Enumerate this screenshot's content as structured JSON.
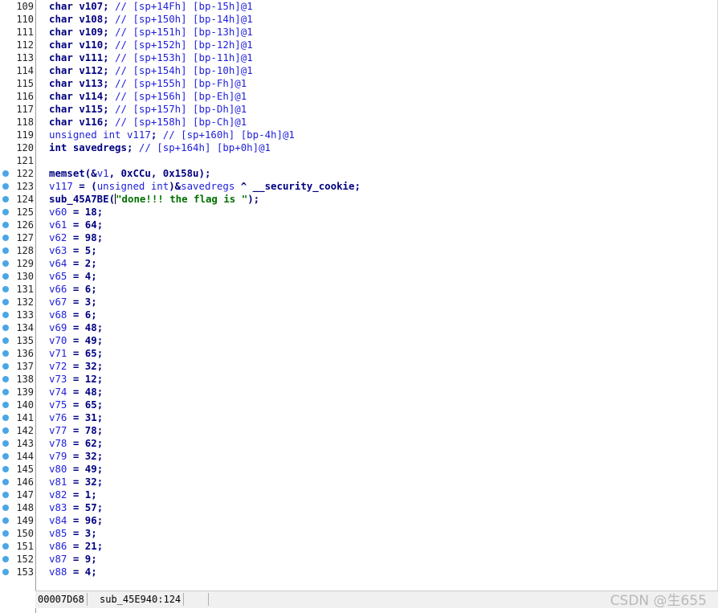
{
  "code_lines": [
    {
      "no": "109",
      "bp": false,
      "segs": [
        [
          "kw",
          "char "
        ],
        [
          "id",
          "v107"
        ],
        [
          "kw",
          "; "
        ],
        [
          "cm",
          "// [sp+14Fh] [bp-15h]@1"
        ]
      ]
    },
    {
      "no": "110",
      "bp": false,
      "segs": [
        [
          "kw",
          "char "
        ],
        [
          "id",
          "v108"
        ],
        [
          "kw",
          "; "
        ],
        [
          "cm",
          "// [sp+150h] [bp-14h]@1"
        ]
      ]
    },
    {
      "no": "111",
      "bp": false,
      "segs": [
        [
          "kw",
          "char "
        ],
        [
          "id",
          "v109"
        ],
        [
          "kw",
          "; "
        ],
        [
          "cm",
          "// [sp+151h] [bp-13h]@1"
        ]
      ]
    },
    {
      "no": "112",
      "bp": false,
      "segs": [
        [
          "kw",
          "char "
        ],
        [
          "id",
          "v110"
        ],
        [
          "kw",
          "; "
        ],
        [
          "cm",
          "// [sp+152h] [bp-12h]@1"
        ]
      ]
    },
    {
      "no": "113",
      "bp": false,
      "segs": [
        [
          "kw",
          "char "
        ],
        [
          "id",
          "v111"
        ],
        [
          "kw",
          "; "
        ],
        [
          "cm",
          "// [sp+153h] [bp-11h]@1"
        ]
      ]
    },
    {
      "no": "114",
      "bp": false,
      "segs": [
        [
          "kw",
          "char "
        ],
        [
          "id",
          "v112"
        ],
        [
          "kw",
          "; "
        ],
        [
          "cm",
          "// [sp+154h] [bp-10h]@1"
        ]
      ]
    },
    {
      "no": "115",
      "bp": false,
      "segs": [
        [
          "kw",
          "char "
        ],
        [
          "id",
          "v113"
        ],
        [
          "kw",
          "; "
        ],
        [
          "cm",
          "// [sp+155h] [bp-Fh]@1"
        ]
      ]
    },
    {
      "no": "116",
      "bp": false,
      "segs": [
        [
          "kw",
          "char "
        ],
        [
          "id",
          "v114"
        ],
        [
          "kw",
          "; "
        ],
        [
          "cm",
          "// [sp+156h] [bp-Eh]@1"
        ]
      ]
    },
    {
      "no": "117",
      "bp": false,
      "segs": [
        [
          "kw",
          "char "
        ],
        [
          "id",
          "v115"
        ],
        [
          "kw",
          "; "
        ],
        [
          "cm",
          "// [sp+157h] [bp-Dh]@1"
        ]
      ]
    },
    {
      "no": "118",
      "bp": false,
      "segs": [
        [
          "kw",
          "char "
        ],
        [
          "id",
          "v116"
        ],
        [
          "kw",
          "; "
        ],
        [
          "cm",
          "// [sp+158h] [bp-Ch]@1"
        ]
      ]
    },
    {
      "no": "119",
      "bp": false,
      "segs": [
        [
          "var",
          "unsigned int v117"
        ],
        [
          "kw",
          "; "
        ],
        [
          "cm",
          "// [sp+160h] [bp-4h]@1"
        ]
      ]
    },
    {
      "no": "120",
      "bp": false,
      "segs": [
        [
          "kw",
          "int savedregs; "
        ],
        [
          "cm",
          "// [sp+164h] [bp+0h]@1"
        ]
      ]
    },
    {
      "no": "121",
      "bp": false,
      "segs": []
    },
    {
      "no": "122",
      "bp": true,
      "segs": [
        [
          "kw",
          "memset(&"
        ],
        [
          "var",
          "v1"
        ],
        [
          "kw",
          ", 0xCCu, 0x158u);"
        ]
      ]
    },
    {
      "no": "123",
      "bp": true,
      "segs": [
        [
          "var",
          "v117"
        ],
        [
          "kw",
          " = ("
        ],
        [
          "var",
          "unsigned int"
        ],
        [
          "kw",
          ")&"
        ],
        [
          "var",
          "savedregs"
        ],
        [
          "kw",
          " ^ __security_cookie;"
        ]
      ]
    },
    {
      "no": "124",
      "bp": true,
      "segs": [
        [
          "kw",
          "sub_45A7BE("
        ],
        [
          "cursor",
          ""
        ],
        [
          "str",
          "\"done!!! the flag is \""
        ],
        [
          "kw",
          ");"
        ]
      ]
    },
    {
      "no": "125",
      "bp": true,
      "segs": [
        [
          "var",
          "v60"
        ],
        [
          "kw",
          " = 18;"
        ]
      ]
    },
    {
      "no": "126",
      "bp": true,
      "segs": [
        [
          "var",
          "v61"
        ],
        [
          "kw",
          " = 64;"
        ]
      ]
    },
    {
      "no": "127",
      "bp": true,
      "segs": [
        [
          "var",
          "v62"
        ],
        [
          "kw",
          " = 98;"
        ]
      ]
    },
    {
      "no": "128",
      "bp": true,
      "segs": [
        [
          "var",
          "v63"
        ],
        [
          "kw",
          " = 5;"
        ]
      ]
    },
    {
      "no": "129",
      "bp": true,
      "segs": [
        [
          "var",
          "v64"
        ],
        [
          "kw",
          " = 2;"
        ]
      ]
    },
    {
      "no": "130",
      "bp": true,
      "segs": [
        [
          "var",
          "v65"
        ],
        [
          "kw",
          " = 4;"
        ]
      ]
    },
    {
      "no": "131",
      "bp": true,
      "segs": [
        [
          "var",
          "v66"
        ],
        [
          "kw",
          " = 6;"
        ]
      ]
    },
    {
      "no": "132",
      "bp": true,
      "segs": [
        [
          "var",
          "v67"
        ],
        [
          "kw",
          " = 3;"
        ]
      ]
    },
    {
      "no": "133",
      "bp": true,
      "segs": [
        [
          "var",
          "v68"
        ],
        [
          "kw",
          " = 6;"
        ]
      ]
    },
    {
      "no": "134",
      "bp": true,
      "segs": [
        [
          "var",
          "v69"
        ],
        [
          "kw",
          " = 48;"
        ]
      ]
    },
    {
      "no": "135",
      "bp": true,
      "segs": [
        [
          "var",
          "v70"
        ],
        [
          "kw",
          " = 49;"
        ]
      ]
    },
    {
      "no": "136",
      "bp": true,
      "segs": [
        [
          "var",
          "v71"
        ],
        [
          "kw",
          " = 65;"
        ]
      ]
    },
    {
      "no": "137",
      "bp": true,
      "segs": [
        [
          "var",
          "v72"
        ],
        [
          "kw",
          " = 32;"
        ]
      ]
    },
    {
      "no": "138",
      "bp": true,
      "segs": [
        [
          "var",
          "v73"
        ],
        [
          "kw",
          " = 12;"
        ]
      ]
    },
    {
      "no": "139",
      "bp": true,
      "segs": [
        [
          "var",
          "v74"
        ],
        [
          "kw",
          " = 48;"
        ]
      ]
    },
    {
      "no": "140",
      "bp": true,
      "segs": [
        [
          "var",
          "v75"
        ],
        [
          "kw",
          " = 65;"
        ]
      ]
    },
    {
      "no": "141",
      "bp": true,
      "segs": [
        [
          "var",
          "v76"
        ],
        [
          "kw",
          " = 31;"
        ]
      ]
    },
    {
      "no": "142",
      "bp": true,
      "segs": [
        [
          "var",
          "v77"
        ],
        [
          "kw",
          " = 78;"
        ]
      ]
    },
    {
      "no": "143",
      "bp": true,
      "segs": [
        [
          "var",
          "v78"
        ],
        [
          "kw",
          " = 62;"
        ]
      ]
    },
    {
      "no": "144",
      "bp": true,
      "segs": [
        [
          "var",
          "v79"
        ],
        [
          "kw",
          " = 32;"
        ]
      ]
    },
    {
      "no": "145",
      "bp": true,
      "segs": [
        [
          "var",
          "v80"
        ],
        [
          "kw",
          " = 49;"
        ]
      ]
    },
    {
      "no": "146",
      "bp": true,
      "segs": [
        [
          "var",
          "v81"
        ],
        [
          "kw",
          " = 32;"
        ]
      ]
    },
    {
      "no": "147",
      "bp": true,
      "segs": [
        [
          "var",
          "v82"
        ],
        [
          "kw",
          " = 1;"
        ]
      ]
    },
    {
      "no": "148",
      "bp": true,
      "segs": [
        [
          "var",
          "v83"
        ],
        [
          "kw",
          " = 57;"
        ]
      ]
    },
    {
      "no": "149",
      "bp": true,
      "segs": [
        [
          "var",
          "v84"
        ],
        [
          "kw",
          " = 96;"
        ]
      ]
    },
    {
      "no": "150",
      "bp": true,
      "segs": [
        [
          "var",
          "v85"
        ],
        [
          "kw",
          " = 3;"
        ]
      ]
    },
    {
      "no": "151",
      "bp": true,
      "segs": [
        [
          "var",
          "v86"
        ],
        [
          "kw",
          " = 21;"
        ]
      ]
    },
    {
      "no": "152",
      "bp": true,
      "segs": [
        [
          "var",
          "v87"
        ],
        [
          "kw",
          " = 9;"
        ]
      ]
    },
    {
      "no": "153",
      "bp": true,
      "segs": [
        [
          "var",
          "v88"
        ],
        [
          "kw",
          " = 4;"
        ]
      ]
    }
  ],
  "status": {
    "address": "00007D68",
    "location": "sub_45E940:124"
  },
  "watermark": "CSDN @生655",
  "colors": {
    "keyword": "#000080",
    "variable": "#1e1edc",
    "string": "#007000",
    "breakpoint_dot": "#4aa6e8"
  }
}
